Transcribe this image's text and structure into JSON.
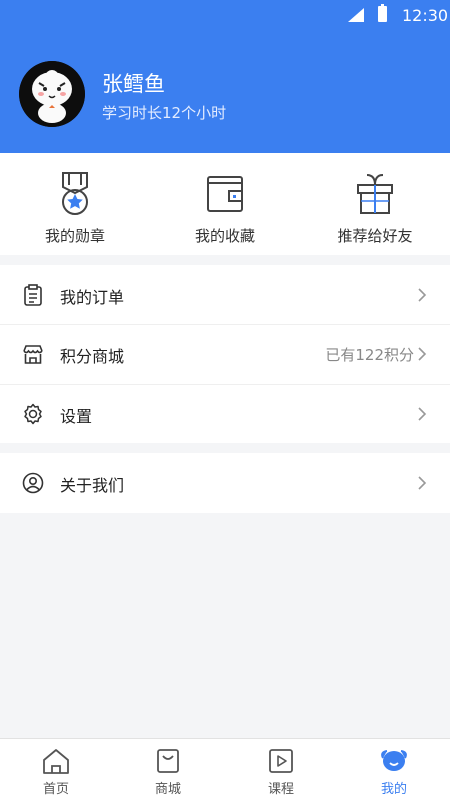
{
  "status_bar": {
    "time": "12:30"
  },
  "profile": {
    "name": "张鳕鱼",
    "study_time": "学习时长12个小时"
  },
  "quick_actions": [
    {
      "label": "我的勋章",
      "icon": "medal-icon"
    },
    {
      "label": "我的收藏",
      "icon": "wallet-icon"
    },
    {
      "label": "推荐给好友",
      "icon": "gift-icon"
    }
  ],
  "menu": {
    "orders": {
      "label": "我的订单",
      "icon": "clipboard-icon"
    },
    "points_mall": {
      "label": "积分商城",
      "icon": "store-icon",
      "value": "已有122积分"
    },
    "settings": {
      "label": "设置",
      "icon": "gear-icon"
    },
    "about": {
      "label": "关于我们",
      "icon": "user-circle-icon"
    }
  },
  "tabs": [
    {
      "label": "首页",
      "icon": "home-icon",
      "active": false
    },
    {
      "label": "商城",
      "icon": "shopping-bag-icon",
      "active": false
    },
    {
      "label": "课程",
      "icon": "play-icon",
      "active": false
    },
    {
      "label": "我的",
      "icon": "profile-face-icon",
      "active": true
    }
  ],
  "colors": {
    "brand": "#3b7ff0",
    "background": "#f4f5f7"
  }
}
